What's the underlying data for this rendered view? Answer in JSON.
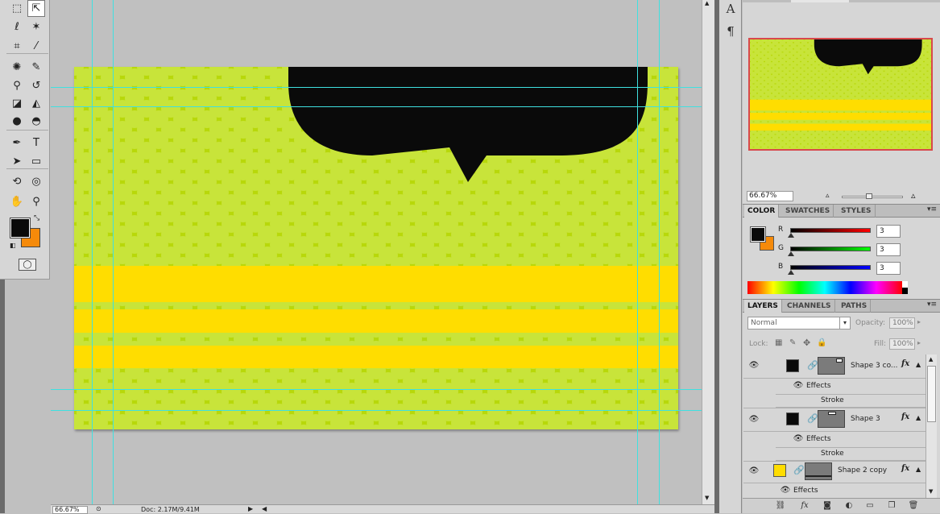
{
  "tools": [
    {
      "name": "rectangular-marquee-tool-icon",
      "glyph": "⬚"
    },
    {
      "name": "move-tool-icon",
      "glyph": "⇱"
    },
    {
      "name": "lasso-tool-icon",
      "glyph": "ℓ"
    },
    {
      "name": "magic-wand-tool-icon",
      "glyph": "✶"
    },
    {
      "name": "crop-tool-icon",
      "glyph": "⌗"
    },
    {
      "name": "eyedropper-tool-icon",
      "glyph": "⁄"
    },
    {
      "name": "spot-healing-tool-icon",
      "glyph": "✺"
    },
    {
      "name": "brush-tool-icon",
      "glyph": "✎"
    },
    {
      "name": "clone-stamp-tool-icon",
      "glyph": "⚲"
    },
    {
      "name": "history-brush-tool-icon",
      "glyph": "↺"
    },
    {
      "name": "eraser-tool-icon",
      "glyph": "◪"
    },
    {
      "name": "paint-bucket-tool-icon",
      "glyph": "◭"
    },
    {
      "name": "blur-tool-icon",
      "glyph": "●"
    },
    {
      "name": "dodge-tool-icon",
      "glyph": "◓"
    },
    {
      "name": "pen-tool-icon",
      "glyph": "✒"
    },
    {
      "name": "type-tool-icon",
      "glyph": "T"
    },
    {
      "name": "path-selection-tool-icon",
      "glyph": "➤"
    },
    {
      "name": "rectangle-shape-tool-icon",
      "glyph": "▭"
    },
    {
      "name": "3d-rotate-tool-icon",
      "glyph": "⟲"
    },
    {
      "name": "3d-orbit-tool-icon",
      "glyph": "◎"
    },
    {
      "name": "hand-tool-icon",
      "glyph": "✋"
    },
    {
      "name": "zoom-tool-icon",
      "glyph": "⚲"
    }
  ],
  "colors": {
    "foreground": "#0a0a0a",
    "background": "#f58a0a",
    "lime": "#b8d80a",
    "yellow": "#ffdd00",
    "guide": "#3fe0e0"
  },
  "mini_dock": {
    "char_icon": "A",
    "paragraph_icon": "¶"
  },
  "navigator": {
    "zoom": "66.67%"
  },
  "color_panel": {
    "tabs": [
      "COLOR",
      "SWATCHES",
      "STYLES"
    ],
    "channels": [
      {
        "label": "R",
        "value": "3"
      },
      {
        "label": "G",
        "value": "3"
      },
      {
        "label": "B",
        "value": "3"
      }
    ]
  },
  "layers_panel": {
    "tabs": [
      "LAYERS",
      "CHANNELS",
      "PATHS"
    ],
    "blend_mode": "Normal",
    "opacity_label": "Opacity:",
    "opacity_value": "100%",
    "lock_label": "Lock:",
    "fill_label": "Fill:",
    "fill_value": "100%",
    "layers": [
      {
        "name": "Shape 3 co...",
        "effects_label": "Effects",
        "effect": "Stroke"
      },
      {
        "name": "Shape 3",
        "effects_label": "Effects",
        "effect": "Stroke"
      },
      {
        "name": "Shape 2 copy",
        "effects_label": "Effects"
      }
    ],
    "fx_label": "fx"
  },
  "status": {
    "zoom": "66.67%",
    "doc": "Doc: 2.17M/9.41M"
  }
}
